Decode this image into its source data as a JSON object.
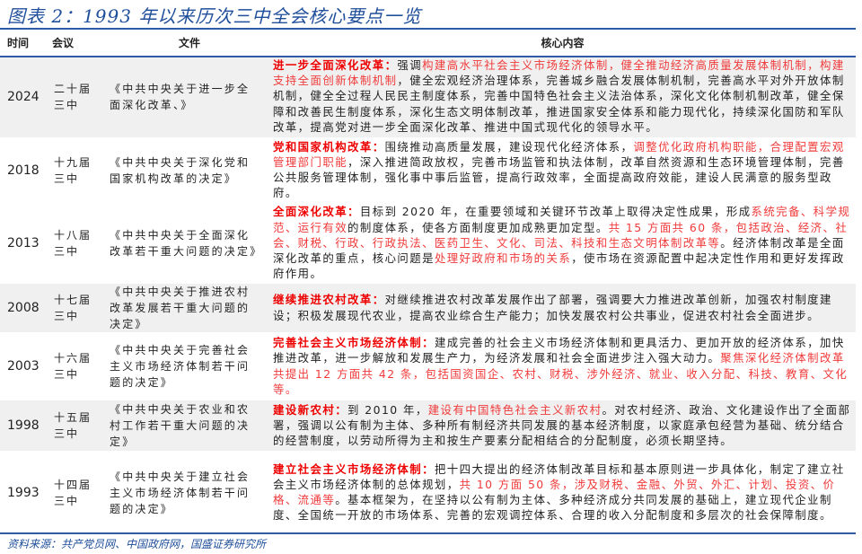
{
  "title": "图表 2：1993 年以来历次三中全会核心要点一览",
  "headers": {
    "time": "时间",
    "meeting": "会议",
    "file": "文件",
    "content": "核心内容"
  },
  "rows": [
    {
      "year": "2024",
      "meeting": "二十届三中",
      "file": "《中共中央关于进一步全面深化改革、》",
      "content": [
        {
          "t": "进一步全面深化改革：",
          "s": "b"
        },
        {
          "t": "强调",
          "s": "n"
        },
        {
          "t": "构建高水平社会主义市场经济体制，健全推动经济高质量发展体制机制，构建支持全面创新体制机制",
          "s": "r"
        },
        {
          "t": "，健全宏观经济治理体系，完善城乡融合发展体制机制，完善高水平对外开放体制机制，健全全过程人民民主制度体系，完善中国特色社会主义法治体系，深化文化体制机制改革，健全保障和改善民生制度体系，深化生态文明体制改革，推进国家安全体系和能力现代化，持续深化国防和军队改革，提高党对进一步全面深化改革、推进中国式现代化的领导水平。",
          "s": "n"
        }
      ]
    },
    {
      "year": "2018",
      "meeting": "十九届三中",
      "file": "《中共中央关于深化党和国家机构改革的决定》",
      "content": [
        {
          "t": "党和国家机构改革：",
          "s": "b"
        },
        {
          "t": "围绕推动高质量发展，建设现代化经济体系，",
          "s": "n"
        },
        {
          "t": "调整优化政府机构职能，合理配置宏观管理部门职能",
          "s": "r"
        },
        {
          "t": "，深入推进简政放权，完善市场监管和执法体制，改革自然资源和生态环境管理体制，完善公共服务管理体制，强化事中事后监管，提高行政效率，全面提高政府效能，建设人民满意的服务型政府。",
          "s": "n"
        }
      ]
    },
    {
      "year": "2013",
      "meeting": "十八届三中",
      "file": "《中共中央关于全面深化改革若干重大问题的决定》",
      "content": [
        {
          "t": "全面深化改革：",
          "s": "b"
        },
        {
          "t": "目标到 2020 年，在重要领域和关键环节改革上取得决定性成果，形成",
          "s": "n"
        },
        {
          "t": "系统完备、科学规范、运行有效",
          "s": "r"
        },
        {
          "t": "的制度体系，使各方面制度更加成熟更加定型。",
          "s": "n"
        },
        {
          "t": "共 15 方面共 60 条，包括政治、经济、社会、财税、行政、行政执法、医药卫生、文化、司法、科技和生态文明体制改革等",
          "s": "r"
        },
        {
          "t": "。经济体制改革是全面深化改革的重点，核心问题是",
          "s": "n"
        },
        {
          "t": "处理好政府和市场的关系",
          "s": "r"
        },
        {
          "t": "，使市场在资源配置中起决定性作用和更好发挥政府作用。",
          "s": "n"
        }
      ]
    },
    {
      "year": "2008",
      "meeting": "十七届三中",
      "file": "《中共中央关于推进农村改革发展若干重大问题的决定》",
      "content": [
        {
          "t": "继续推进农村改革：",
          "s": "b"
        },
        {
          "t": "对继续推进农村改革发展作出了部署，强调要大力推进改革创新，加强农村制度建设；积极发展现代农业，提高农业综合生产能力；加快发展农村公共事业，促进农村社会全面进步。",
          "s": "n"
        }
      ]
    },
    {
      "year": "2003",
      "meeting": "十六届三中",
      "file": "《中共中央关于完善社会主义市场经济体制若干问题的决定》",
      "content": [
        {
          "t": "完善社会主义市场经济体制：",
          "s": "b"
        },
        {
          "t": "建成完善的社会主义市场经济体制和更具活力、更加开放的经济体系，加快推进改革，进一步解放和发展生产力，为经济发展和社会全面进步注入强大动力。",
          "s": "n"
        },
        {
          "t": "聚焦深化经济体制改革共提出 12 方面共 42 条，包括国资国企、农村、财税、涉外经济、就业、收入分配、科技、教育、文化等。",
          "s": "r"
        }
      ]
    },
    {
      "year": "1998",
      "meeting": "十五届三中",
      "file": "《中共中央关于农业和农村工作若干重大问题的决定》",
      "content": [
        {
          "t": "建设新农村：",
          "s": "b"
        },
        {
          "t": "到 2010 年，",
          "s": "n"
        },
        {
          "t": "建设有中国特色社会主义新农村",
          "s": "r"
        },
        {
          "t": "。对农村经济、政治、文化建设作出了全面部署，强调以公有制为主体、多种所有制经济共同发展的基本经济制度，以家庭承包经营为基础、统分结合的经营制度，以劳动所得为主和按生产要素分配相结合的分配制度，必须长期坚持。",
          "s": "n"
        }
      ]
    },
    {
      "year": "1993",
      "meeting": "十四届三中",
      "file": "《中共中央关于建立社会主义市场经济体制若干问题的决定》",
      "content": [
        {
          "t": "建立社会主义市场经济体制：",
          "s": "b"
        },
        {
          "t": "把十四大提出的经济体制改革目标和基本原则进一步具体化，制定了建立社会主义市场经济体制的总体规划，",
          "s": "n"
        },
        {
          "t": "共 10 方面 50 条，涉及财税、金融、外贸、外汇、计划、投资、价格、流通等",
          "s": "r"
        },
        {
          "t": "。基本框架为，在坚持以公有制为主体、多种经济成分共同发展的基础上，建立现代企业制度、全国统一开放的市场体系、完善的宏观调控体系、合理的收入分配制度和多层次的社会保障制度。",
          "s": "n"
        }
      ]
    }
  ],
  "source": "资料来源：共产党员网、中国政府网，国盛证券研究所"
}
